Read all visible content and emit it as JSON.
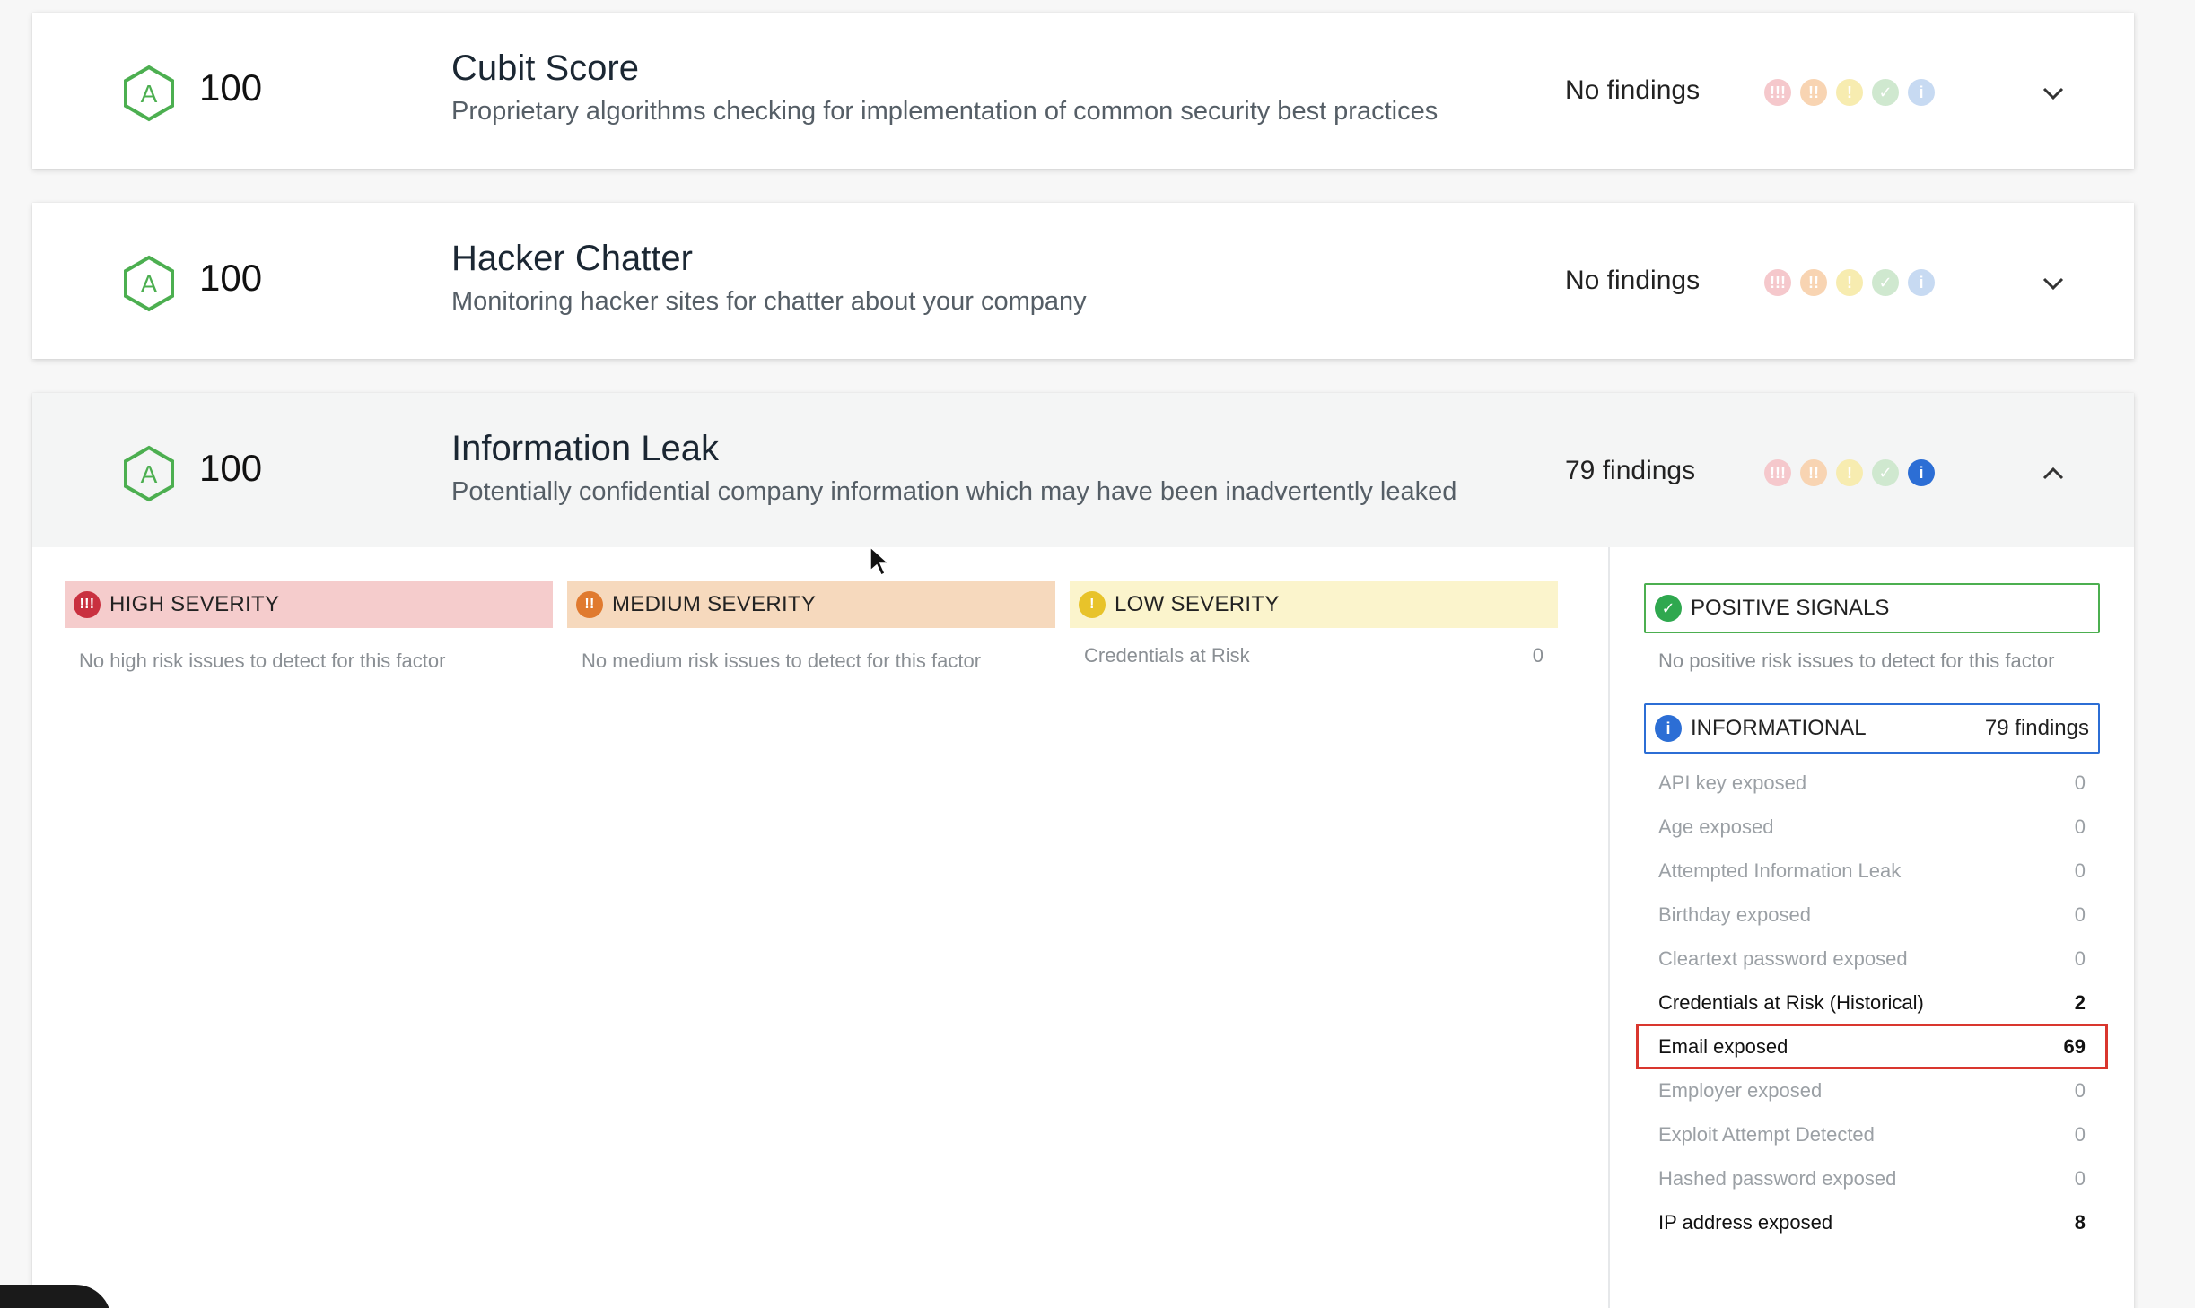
{
  "factors": [
    {
      "grade": "A",
      "score": "100",
      "title": "Cubit Score",
      "description": "Proprietary algorithms checking for implementation of common security best practices",
      "findings": "No findings"
    },
    {
      "grade": "A",
      "score": "100",
      "title": "Hacker Chatter",
      "description": "Monitoring hacker sites for chatter about your company",
      "findings": "No findings"
    },
    {
      "grade": "A",
      "score": "100",
      "title": "Information Leak",
      "description": "Potentially confidential company information which may have been inadvertently leaked",
      "findings": "79 findings"
    }
  ],
  "severity": {
    "high": {
      "label": "HIGH SEVERITY",
      "note": "No high risk issues to detect for this factor"
    },
    "medium": {
      "label": "MEDIUM SEVERITY",
      "note": "No medium risk issues to detect for this factor"
    },
    "low": {
      "label": "LOW SEVERITY",
      "items": [
        {
          "name": "Credentials at Risk",
          "count": "0"
        }
      ]
    }
  },
  "positive": {
    "label": "POSITIVE SIGNALS",
    "note": "No positive risk issues to detect for this factor"
  },
  "informational": {
    "label": "INFORMATIONAL",
    "count": "79 findings",
    "items": [
      {
        "name": "API key exposed",
        "count": "0"
      },
      {
        "name": "Age exposed",
        "count": "0"
      },
      {
        "name": "Attempted Information Leak",
        "count": "0"
      },
      {
        "name": "Birthday exposed",
        "count": "0"
      },
      {
        "name": "Cleartext password exposed",
        "count": "0"
      },
      {
        "name": "Credentials at Risk (Historical)",
        "count": "2"
      },
      {
        "name": "Email exposed",
        "count": "69"
      },
      {
        "name": "Employer exposed",
        "count": "0"
      },
      {
        "name": "Exploit Attempt Detected",
        "count": "0"
      },
      {
        "name": "Hashed password exposed",
        "count": "0"
      },
      {
        "name": "IP address exposed",
        "count": "8"
      }
    ]
  },
  "colors": {
    "grade_green": "#4caf50",
    "highlight_red": "#d9362e",
    "info_blue": "#2c6ed5"
  }
}
